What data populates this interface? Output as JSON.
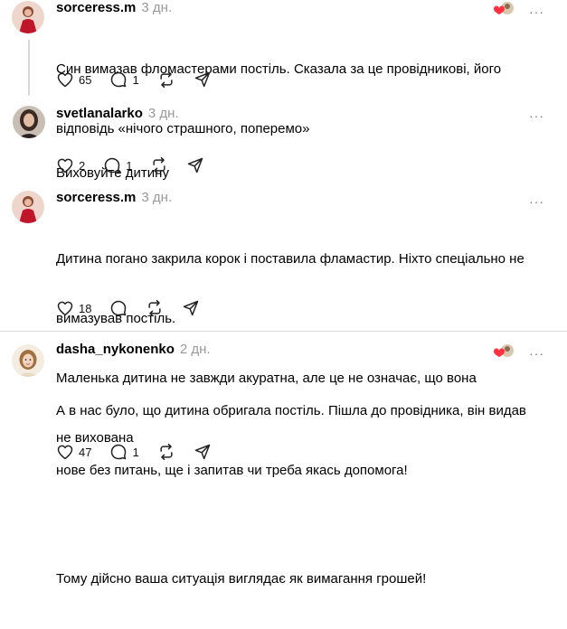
{
  "posts": [
    {
      "username": "sorceress.m",
      "time": "3 дн.",
      "lines": [
        "Син вимазав фломастерами постіль. Сказала за це провідникові, його",
        "відповідь «нічого страшного, поперемо»"
      ],
      "likes": "65",
      "comments": "1",
      "avatar": "woman-red-dress-avatar",
      "reactors": true
    },
    {
      "username": "svetlanalarko",
      "time": "3 дн.",
      "lines": [
        "Виховуйте дитину"
      ],
      "likes": "2",
      "comments": "1",
      "avatar": "woman-dark-hair-avatar",
      "reactors": false
    },
    {
      "username": "sorceress.m",
      "time": "3 дн.",
      "lines": [
        "Дитина погано закрила корок і поставила фламастир. Ніхто спеціально не",
        "вимазував постіль.",
        "Маленька дитина не завжди акуратна, але це не означає, що вона",
        "не вихована"
      ],
      "likes": "18",
      "comments": "",
      "avatar": "woman-red-dress-avatar",
      "reactors": false
    },
    {
      "username": "dasha_nykonenko",
      "time": "2 дн.",
      "lines": [
        "А в нас було, що дитина обригала постіль. Пішла до провідника, він видав",
        "нове без питань, ще і запитав чи треба якась допомога!",
        "",
        "Тому дійсно ваша ситуація виглядає як вимагання грошей!"
      ],
      "likes": "47",
      "comments": "1",
      "avatar": "woman-illustrated-avatar",
      "reactors": true
    }
  ],
  "icons": {
    "like": "heart-icon",
    "comment": "comment-icon",
    "repost": "repost-icon",
    "share": "share-icon",
    "more": "more-icon"
  },
  "colors": {
    "time": "#999999",
    "thread_line": "#d9d9d9",
    "reaction_heart": "#ff3040"
  }
}
